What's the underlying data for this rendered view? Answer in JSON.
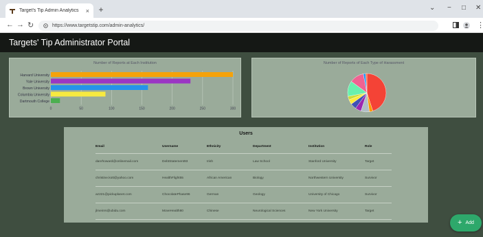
{
  "browser": {
    "tab_title": "Target's Tip Admin Analytics",
    "tab_close": "×",
    "new_tab": "+",
    "url": "https://www.targetstip.com/admin-analytics/"
  },
  "header": {
    "title": "Targets' Tip Administrator Portal"
  },
  "chart_data": [
    {
      "type": "bar",
      "orientation": "horizontal",
      "title": "Number of Reports at Each Institution",
      "categories": [
        "Harvard University",
        "Yale University",
        "Brown University",
        "Columbia University",
        "Dartmouth College"
      ],
      "values": [
        300,
        230,
        160,
        90,
        15
      ],
      "colors": [
        "#f5a20a",
        "#9b35c4",
        "#2592ea",
        "#f7ea40",
        "#4caf50"
      ],
      "x_ticks": [
        0,
        50,
        100,
        150,
        200,
        250,
        300
      ],
      "xlim": [
        0,
        300
      ]
    },
    {
      "type": "pie",
      "title": "Number of Reports of Each Type of Harassment",
      "values": [
        45,
        3,
        7,
        5,
        5,
        4,
        3,
        13,
        12,
        2,
        1
      ],
      "colors": [
        "#f44336",
        "#ff9800",
        "#b0bec5",
        "#9c27b0",
        "#3f51b5",
        "#ffeb3b",
        "#cddc39",
        "#69f0ae",
        "#f06292",
        "#2196f3",
        "#ff5722"
      ]
    }
  ],
  "users": {
    "title": "Users",
    "columns": [
      "Email",
      "Username",
      "Ethnicity",
      "Department",
      "Institution",
      "Role"
    ],
    "rows": [
      [
        "danrhoward@onlinemail.com",
        "DebtStatement93",
        "Irish",
        "Law School",
        "Stanford University",
        "Target"
      ],
      [
        "christine.kott@yahoo.com",
        "HealthFlight55",
        "African American",
        "Biology",
        "Northwestern University",
        "Survivor"
      ],
      [
        "az221@pickuplanet.com",
        "ChocolatePhase96",
        "German",
        "Geology",
        "University of Chicago",
        "Survivor"
      ],
      [
        "jlmeinrs@ubidu.com",
        "MoveHealth80",
        "Chinese",
        "Neurological Sciences",
        "New York University",
        "Target"
      ]
    ]
  },
  "fab": {
    "plus": "+",
    "label": "Add"
  }
}
